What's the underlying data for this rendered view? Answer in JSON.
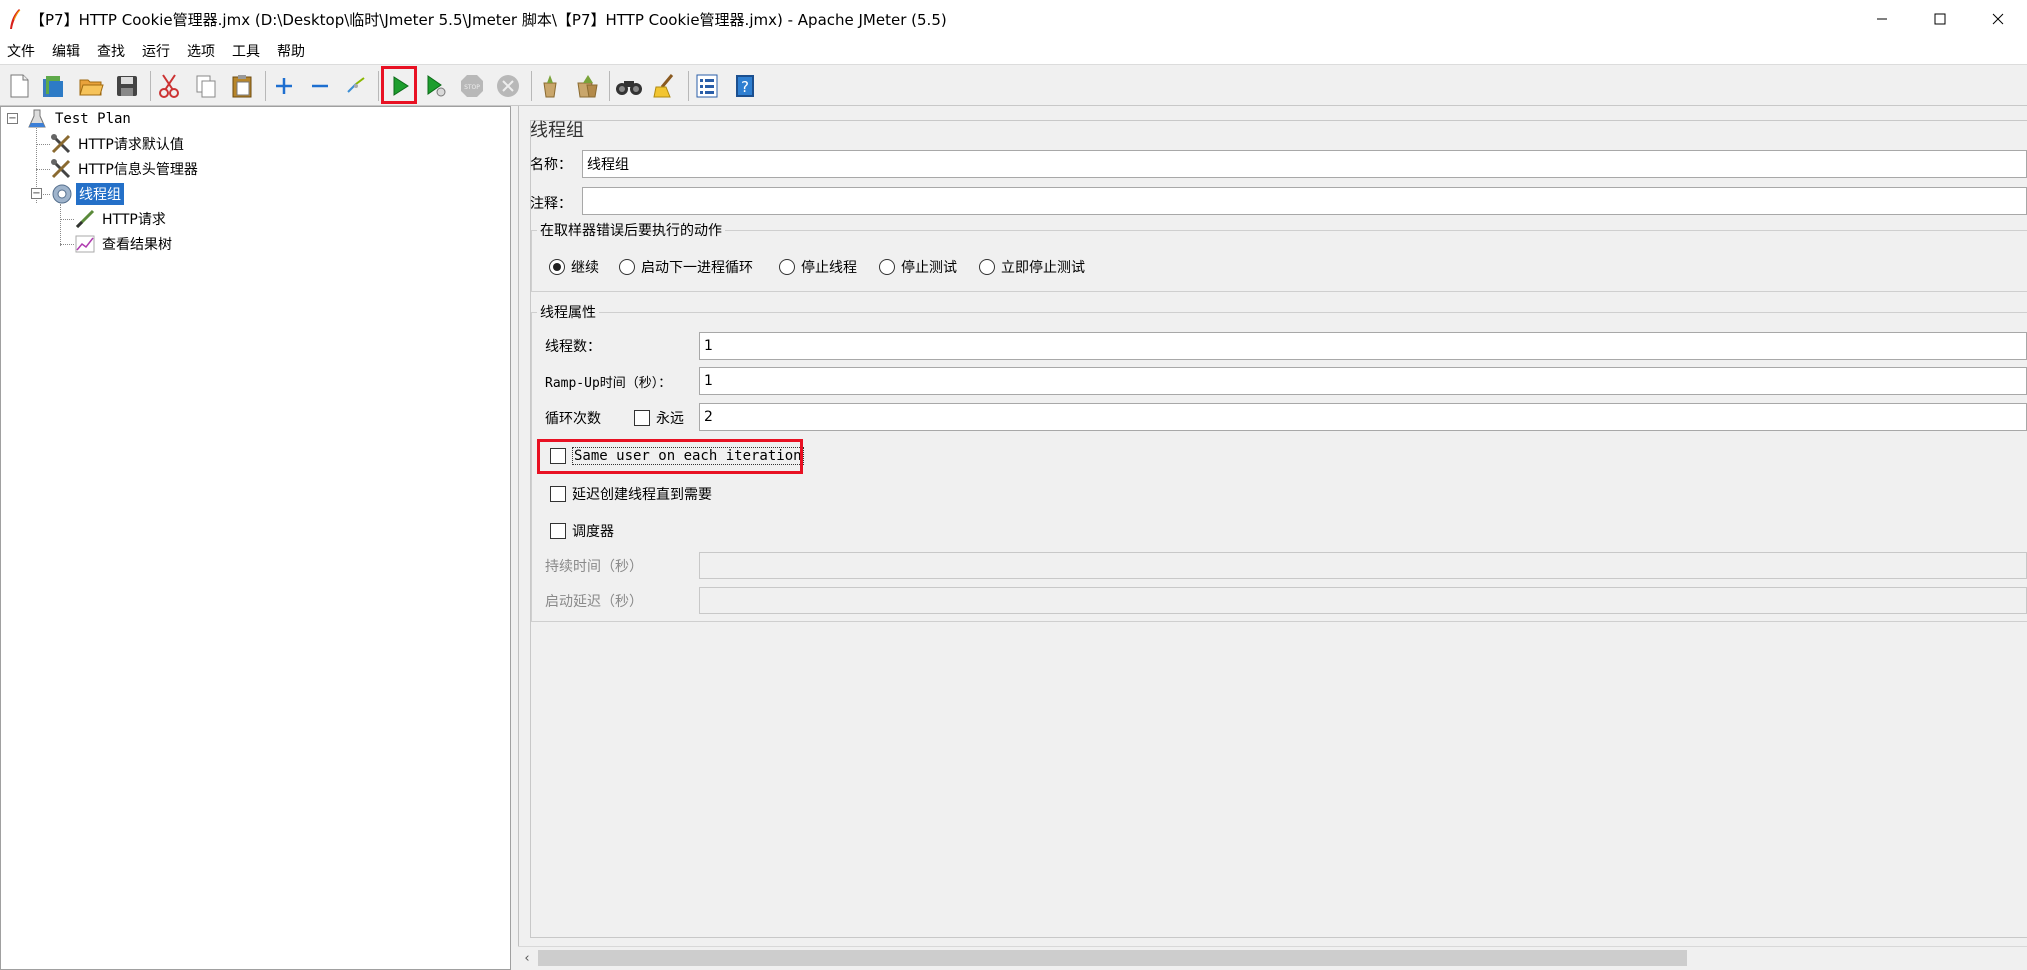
{
  "window": {
    "title": "【P7】HTTP Cookie管理器.jmx (D:\\Desktop\\临时\\Jmeter 5.5\\Jmeter 脚本\\【P7】HTTP Cookie管理器.jmx) - Apache JMeter (5.5)",
    "controls": [
      "minimize-icon",
      "maximize-icon",
      "close-icon"
    ]
  },
  "menu": [
    "文件",
    "编辑",
    "查找",
    "运行",
    "选项",
    "工具",
    "帮助"
  ],
  "toolbar": {
    "icons": [
      "new-icon",
      "templates-icon",
      "open-icon",
      "save-icon",
      "cut-icon",
      "copy-icon",
      "paste-icon",
      "expand-icon",
      "collapse-icon",
      "toggle-icon",
      "start-icon",
      "start-no-pauses-icon",
      "stop-icon",
      "shutdown-icon",
      "clear-icon",
      "clear-all-icon",
      "search-icon",
      "reset-search-icon",
      "function-helper-icon",
      "help-icon"
    ],
    "highlight_color": "#e81123"
  },
  "tree": [
    {
      "label": "Test Plan",
      "level": 0,
      "icon": "test-plan-icon"
    },
    {
      "label": "HTTP请求默认值",
      "level": 1,
      "icon": "config-element-icon"
    },
    {
      "label": "HTTP信息头管理器",
      "level": 1,
      "icon": "config-element-icon"
    },
    {
      "label": "线程组",
      "level": 1,
      "icon": "thread-group-icon",
      "selected": true
    },
    {
      "label": "HTTP请求",
      "level": 2,
      "icon": "sampler-icon"
    },
    {
      "label": "查看结果树",
      "level": 2,
      "icon": "listener-icon"
    }
  ],
  "panel": {
    "title": "线程组",
    "name_label": "名称：",
    "name_value": "线程组",
    "comment_label": "注释：",
    "comment_value": "",
    "error_action": {
      "title": "在取样器错误后要执行的动作",
      "options": [
        "继续",
        "启动下一进程循环",
        "停止线程",
        "停止测试",
        "立即停止测试"
      ],
      "selected": "继续"
    },
    "thread_props": {
      "title": "线程属性",
      "threads_label": "线程数：",
      "threads_value": "1",
      "rampup_label": "Ramp-Up时间（秒）：",
      "rampup_value": "1",
      "loop_label": "循环次数",
      "forever_label": "永远",
      "forever_checked": false,
      "loop_value": "2",
      "same_user_label": "Same user on each iteration",
      "same_user_checked": false,
      "delay_label": "延迟创建线程直到需要",
      "delay_checked": false,
      "scheduler_label": "调度器",
      "scheduler_checked": false,
      "duration_label": "持续时间（秒）",
      "duration_value": "",
      "startup_delay_label": "启动延迟（秒）",
      "startup_delay_value": ""
    }
  }
}
